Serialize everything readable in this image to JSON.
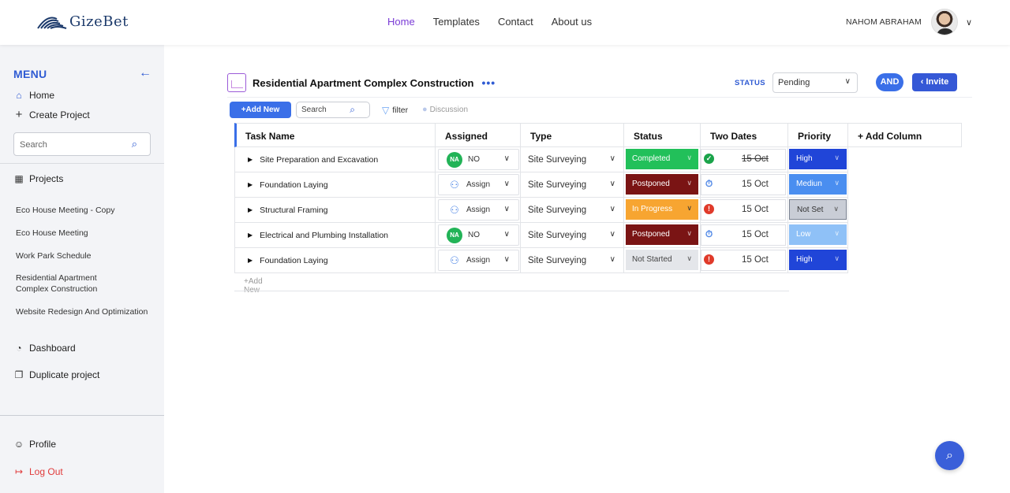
{
  "brand": {
    "name": "GizeBet"
  },
  "nav": {
    "items": [
      "Home",
      "Templates",
      "Contact",
      "About us"
    ],
    "active": "Home"
  },
  "user": {
    "name": "NAHOM ABRAHAM"
  },
  "sidebar": {
    "menu_title": "MENU",
    "home": "Home",
    "create_project": "Create Project",
    "search_placeholder": "Search",
    "projects_label": "Projects",
    "projects": [
      "Eco House Meeting - Copy",
      "Eco House Meeting",
      "Work Park Schedule",
      "Residential Apartment Complex Construction",
      "Website Redesign And Optimization"
    ],
    "dashboard": "Dashboard",
    "duplicate_project": "Duplicate project",
    "profile": "Profile",
    "logout": "Log Out"
  },
  "project": {
    "title": "Residential Apartment Complex Construction",
    "status_label": "STATUS",
    "status_value": "Pending",
    "and_label": "AND",
    "invite_label": "Invite"
  },
  "toolbar": {
    "add_new": "+Add New",
    "search_placeholder": "Search",
    "filter": "filter",
    "discussion": "Discussion"
  },
  "table": {
    "headers": [
      "Task Name",
      "Assigned",
      "Type",
      "Status",
      "Two Dates",
      "Priority",
      "+ Add Column"
    ],
    "rows": [
      {
        "task": "Site Preparation and Excavation",
        "assigned": "NO",
        "assigned_badge": "NA",
        "type": "Site Surveying",
        "status": "Completed",
        "date": "15 Oct",
        "date_icon": "check-circle",
        "priority": "High"
      },
      {
        "task": "Foundation Laying",
        "assigned": "Assign",
        "assigned_badge": "",
        "type": "Site Surveying",
        "status": "Postponed",
        "date": "15 Oct",
        "date_icon": "stopwatch",
        "priority": "Mediun"
      },
      {
        "task": "Structural Framing",
        "assigned": "Assign",
        "assigned_badge": "",
        "type": "Site Surveying",
        "status": "In Progress",
        "date": "15 Oct",
        "date_icon": "alert-circle",
        "priority": "Not Set"
      },
      {
        "task": "Electrical and Plumbing Installation",
        "assigned": "NO",
        "assigned_badge": "NA",
        "type": "Site Surveying",
        "status": "Postponed",
        "date": "15 Oct",
        "date_icon": "stopwatch",
        "priority": "Low"
      },
      {
        "task": "Foundation Laying",
        "assigned": "Assign",
        "assigned_badge": "",
        "type": "Site Surveying",
        "status": "Not Started",
        "date": "15 Oct",
        "date_icon": "alert-circle",
        "priority": "High"
      }
    ],
    "add_row": "+Add New"
  },
  "colors": {
    "accent": "#3a6fe8",
    "nav_active": "#7a3bd6",
    "status_completed": "#22c05a",
    "status_postponed": "#7a1414",
    "status_in_progress": "#f7a531",
    "status_not_started": "#e4e6ea",
    "priority_high": "#2045d8",
    "priority_medium": "#4a8ef0",
    "priority_not_set": "#c9cdd6",
    "priority_low": "#8fc1f7"
  }
}
